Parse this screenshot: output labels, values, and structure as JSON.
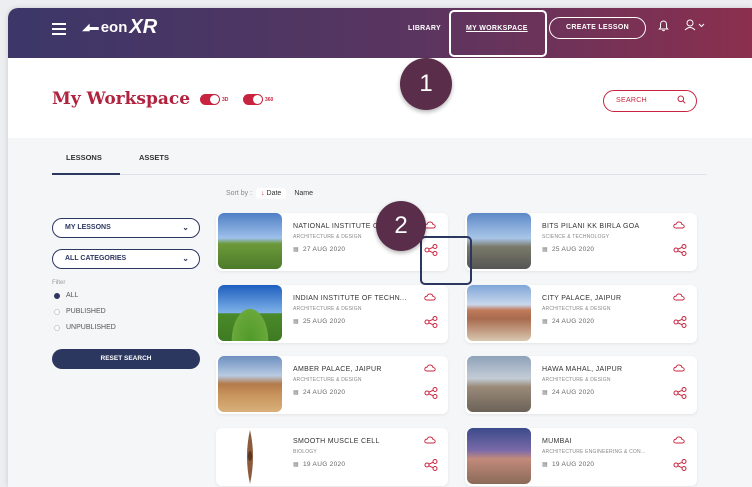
{
  "topbar": {
    "logo_mark": "◢▬",
    "logo_eon": "eon",
    "logo_xr": "XR",
    "nav_library": "LIBRARY",
    "nav_workspace": "MY WORKSPACE",
    "create_lesson": "CREATE LESSON",
    "bell_icon": "♫",
    "user_icon": "♀˅"
  },
  "markers": {
    "m1": "1",
    "m2": "2"
  },
  "header": {
    "title": "My Workspace",
    "toggle_3d": "3D",
    "toggle_360": "360",
    "search_placeholder": "SEARCH"
  },
  "tabs": {
    "lessons": "LESSONS",
    "assets": "ASSETS"
  },
  "sort": {
    "label": "Sort by :",
    "date": "Date",
    "name": "Name"
  },
  "sidebar": {
    "dropdown1": "MY LESSONS",
    "dropdown2": "ALL CATEGORIES",
    "filter_label": "Filter",
    "radio_all": "ALL",
    "radio_published": "PUBLISHED",
    "radio_unpublished": "UNPUBLISHED",
    "reset": "RESET SEARCH"
  },
  "cards": [
    {
      "title": "NATIONAL INSTITUTE OF TECHN...",
      "category": "ARCHITECTURE & DESIGN",
      "date": "27 AUG 2020"
    },
    {
      "title": "BITS PILANI KK BIRLA GOA",
      "category": "SCIENCE & TECHNOLOGY",
      "date": "25 AUG 2020"
    },
    {
      "title": "INDIAN INSTITUTE OF TECHN...",
      "category": "ARCHITECTURE & DESIGN",
      "date": "25 AUG 2020"
    },
    {
      "title": "CITY PALACE, JAIPUR",
      "category": "ARCHITECTURE & DESIGN",
      "date": "24 AUG 2020"
    },
    {
      "title": "AMBER PALACE, JAIPUR",
      "category": "ARCHITECTURE & DESIGN",
      "date": "24 AUG 2020"
    },
    {
      "title": "HAWA MAHAL, JAIPUR",
      "category": "ARCHITECTURE & DESIGN",
      "date": "24 AUG 2020"
    },
    {
      "title": "SMOOTH MUSCLE CELL",
      "category": "BIOLOGY",
      "date": "19 AUG 2020"
    },
    {
      "title": "MUMBAI",
      "category": "ARCHITECTURE ENGINEERING & CON...",
      "date": "19 AUG 2020"
    }
  ],
  "colors": {
    "accent": "#c8243f",
    "navy": "#2c3760"
  }
}
